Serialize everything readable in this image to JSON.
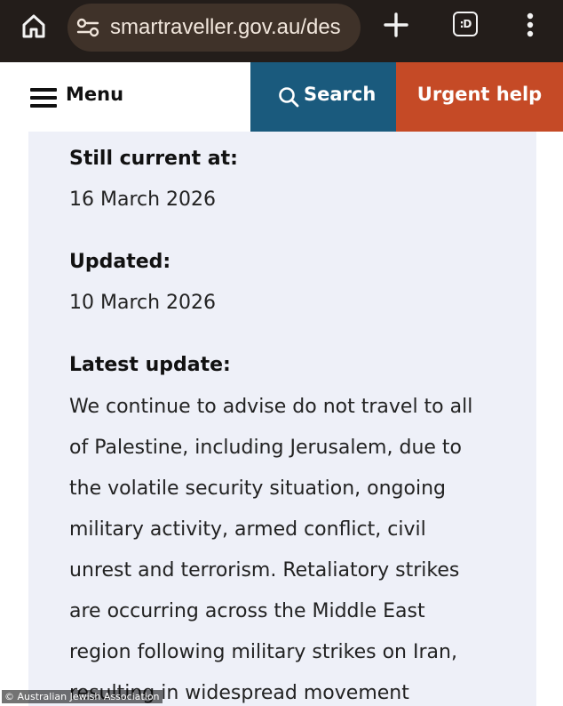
{
  "browser": {
    "url": "smartraveller.gov.au/des",
    "tab_switcher_label": ":D"
  },
  "header": {
    "menu_label": "Menu",
    "search_label": "Search",
    "urgent_label": "Urgent help"
  },
  "content": {
    "still_current_label": "Still current at:",
    "still_current_value": "16 March 2026",
    "updated_label": "Updated:",
    "updated_value": "10 March 2026",
    "latest_update_label": "Latest update:",
    "latest_update_lines": [
      "We continue to advise do not travel to all",
      "of Palestine, including Jerusalem, due to",
      "the volatile security situation, ongoing",
      "military activity, armed conflict, civil",
      "unrest and terrorism. Retaliatory strikes",
      "are occurring across the Middle East",
      "region following military strikes on Iran,",
      "resulting in widespread movement"
    ]
  },
  "watermark": "© Australian Jewish Association",
  "colors": {
    "browser_bar": "#231d1a",
    "search_button": "#1a5a7d",
    "urgent_button": "#c54a26",
    "card_background": "#eef0f8"
  }
}
